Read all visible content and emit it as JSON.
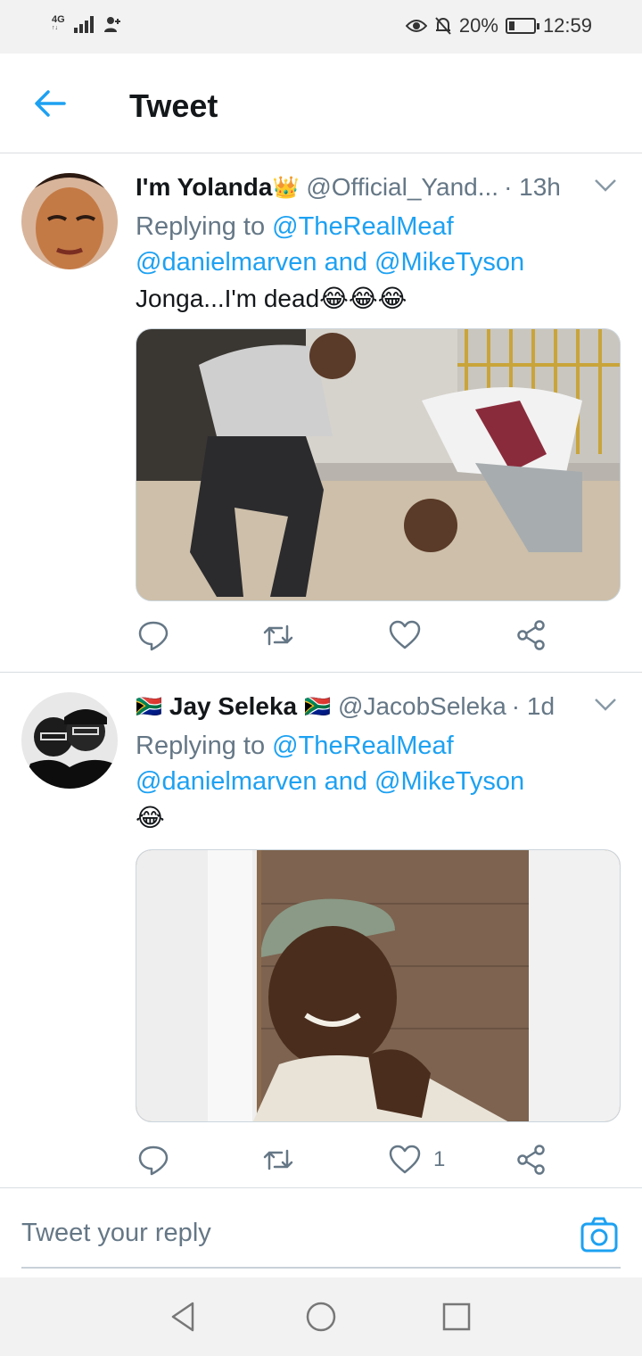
{
  "status_bar": {
    "network": "4G",
    "battery": "20%",
    "time": "12:59"
  },
  "header": {
    "title": "Tweet"
  },
  "tweets": [
    {
      "name": "I'm Yolanda",
      "name_emoji": "👑",
      "handle": "@Official_Yand...",
      "time": "· 13h",
      "replying_prefix": "Replying to ",
      "replying_to_1": "@TheRealMeaf",
      "replying_to_2": "@danielmarven",
      "replying_and": " and ",
      "replying_to_3": "@MikeTyson",
      "text": "Jonga...I'm dead😂😂😂",
      "like_count": ""
    },
    {
      "name": "Jay Seleka",
      "name_flag": "🇿🇦",
      "handle": "@JacobSeleka",
      "time": "· 1d",
      "replying_prefix": "Replying to ",
      "replying_to_1": "@TheRealMeaf",
      "replying_to_2": "@danielmarven",
      "replying_and": " and ",
      "replying_to_3": "@MikeTyson",
      "text": "😂",
      "like_count": "1"
    }
  ],
  "composer": {
    "placeholder": "Tweet your reply"
  },
  "colors": {
    "accent": "#1da1f2",
    "secondary_text": "#657786",
    "divider": "#d9dde1"
  },
  "icons": [
    "back-arrow-icon",
    "chevron-down-icon",
    "reply-icon",
    "retweet-icon",
    "like-icon",
    "share-icon",
    "camera-icon",
    "nav-back-icon",
    "nav-home-icon",
    "nav-recents-icon"
  ]
}
